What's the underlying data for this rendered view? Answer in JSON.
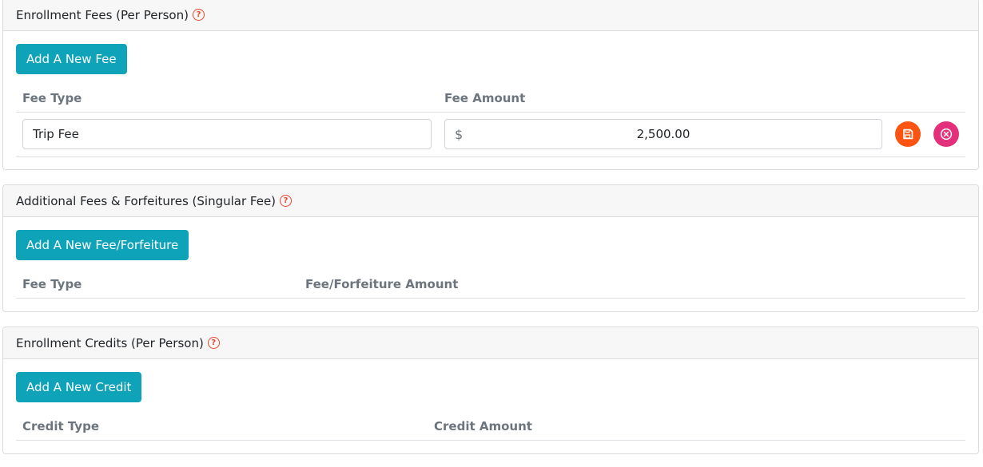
{
  "enrollment_fees": {
    "title": "Enrollment Fees (Per Person)",
    "help_icon": "question-circle-icon",
    "add_button": "Add A New Fee",
    "columns": [
      "Fee Type",
      "Fee Amount"
    ],
    "rows": [
      {
        "fee_type": "Trip Fee",
        "currency": "$",
        "amount": "2,500.00",
        "save_icon": "save-icon",
        "cancel_icon": "close-circle-icon"
      }
    ]
  },
  "additional_fees": {
    "title": "Additional Fees & Forfeitures (Singular Fee)",
    "help_icon": "question-circle-icon",
    "add_button": "Add A New Fee/Forfeiture",
    "columns": [
      "Fee Type",
      "Fee/Forfeiture Amount"
    ]
  },
  "enrollment_credits": {
    "title": "Enrollment Credits (Per Person)",
    "help_icon": "question-circle-icon",
    "add_button": "Add A New Credit",
    "columns": [
      "Credit Type",
      "Credit Amount"
    ]
  },
  "colors": {
    "primary_button": "#0fa3b9",
    "save_button": "#fd5412",
    "cancel_button": "#e4307a",
    "help_icon": "#e8492b"
  }
}
